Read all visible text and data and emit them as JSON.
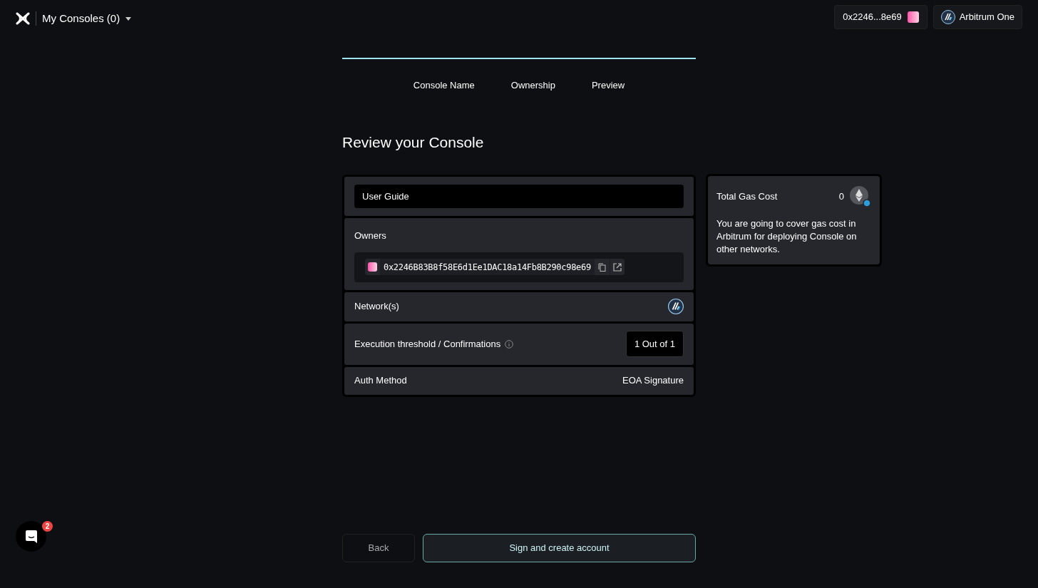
{
  "header": {
    "title": "My Consoles (0)",
    "wallet": "0x2246...8e69",
    "network": "Arbitrum One"
  },
  "progress": {
    "level": 1
  },
  "steps": [
    "Console Name",
    "Ownership",
    "Preview"
  ],
  "heading": "Review your Console",
  "rows": [
    {
      "kind": "field",
      "value": "User Guide"
    },
    {
      "kind": "owners",
      "label": "Owners",
      "address": "0x2246B83B8f58E6d1Ee1DAC18a14Fb8B290c98e69"
    },
    {
      "kind": "networks",
      "label": "Network(s)"
    },
    {
      "kind": "threshold",
      "label": "Execution threshold / Confirmations",
      "value": "1 Out of 1"
    },
    {
      "kind": "text",
      "label": "Auth Method",
      "value": "EOA Signature"
    }
  ],
  "gas": {
    "label": "Total Gas Cost",
    "amount": "0",
    "note": "You are going to cover gas cost in Arbitrum for deploying Console on other networks."
  },
  "chat": {
    "badge": "2"
  },
  "buttons": {
    "back": "Back",
    "primary": "Sign and create account"
  }
}
